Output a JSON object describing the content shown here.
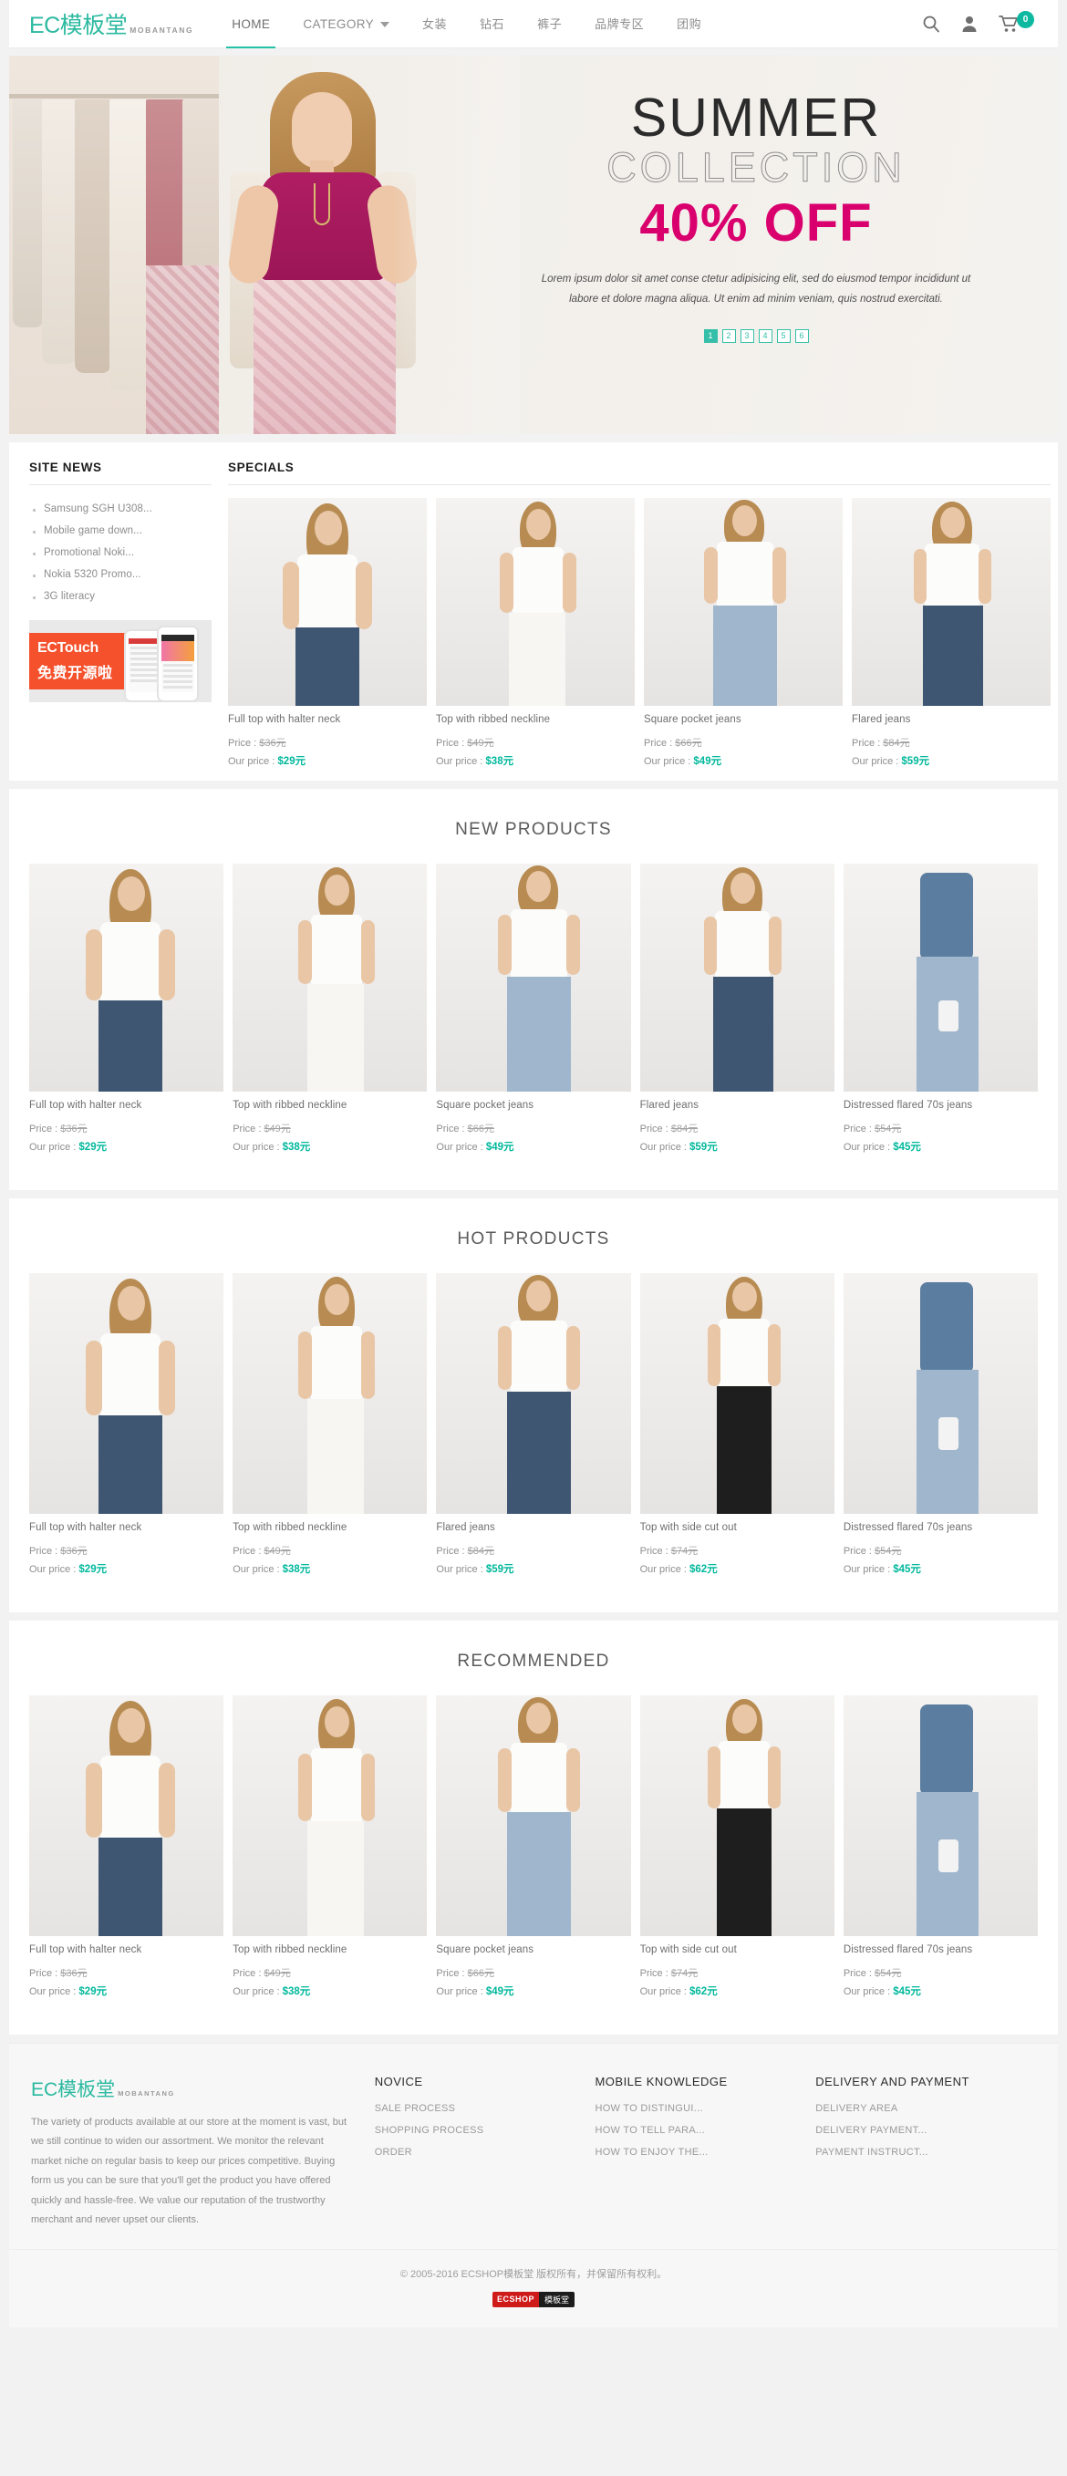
{
  "header": {
    "logo_main": "EC模板堂",
    "logo_sub": "MOBANTANG",
    "nav": [
      {
        "label": "HOME",
        "active": true,
        "caret": false
      },
      {
        "label": "CATEGORY",
        "active": false,
        "caret": true
      },
      {
        "label": "女装",
        "active": false,
        "caret": false
      },
      {
        "label": "钻石",
        "active": false,
        "caret": false
      },
      {
        "label": "裤子",
        "active": false,
        "caret": false
      },
      {
        "label": "品牌专区",
        "active": false,
        "caret": false
      },
      {
        "label": "团购",
        "active": false,
        "caret": false
      }
    ],
    "search_icon": "search-icon",
    "account_icon": "user-icon",
    "cart_icon": "cart-icon",
    "cart_count": "0",
    "accent_color": "#2bb9a0"
  },
  "banner": {
    "title": "SUMMER",
    "subtitle": "COLLECTION",
    "offer": "40% OFF",
    "description": "Lorem ipsum dolor sit amet conse ctetur adipisicing elit, sed do eiusmod tempor incididunt ut labore et dolore magna aliqua. Ut enim ad minim veniam, quis nostrud exercitati.",
    "pager": [
      "1",
      "2",
      "3",
      "4",
      "5",
      "6"
    ],
    "active_page": "1",
    "offer_color": "#d9006e",
    "pager_color": "#35bfa9"
  },
  "site_news": {
    "heading": "SITE NEWS",
    "items": [
      "Samsung SGH U308...",
      "Mobile game down...",
      "Promotional Noki...",
      "Nokia 5320 Promo...",
      "3G literacy"
    ]
  },
  "ad": {
    "line1": "ECTouch",
    "line2": "免费开源啦"
  },
  "specials": {
    "heading": "SPECIALS",
    "products": [
      {
        "title": "Full top with halter neck",
        "price": "Price : ",
        "price_value": "$36元",
        "our_label": "Our price : ",
        "our_value": "$29元"
      },
      {
        "title": "Top with ribbed neckline",
        "price": "Price : ",
        "price_value": "$49元",
        "our_label": "Our price : ",
        "our_value": "$38元"
      },
      {
        "title": "Square pocket jeans",
        "price": "Price : ",
        "price_value": "$66元",
        "our_label": "Our price : ",
        "our_value": "$49元"
      },
      {
        "title": "Flared jeans",
        "price": "Price : ",
        "price_value": "$84元",
        "our_label": "Our price : ",
        "our_value": "$59元"
      }
    ]
  },
  "new_products": {
    "heading": "NEW PRODUCTS",
    "products": [
      {
        "title": "Full top with halter neck",
        "price": "Price : ",
        "price_value": "$36元",
        "our_label": "Our price : ",
        "our_value": "$29元"
      },
      {
        "title": "Top with ribbed neckline",
        "price": "Price : ",
        "price_value": "$49元",
        "our_label": "Our price : ",
        "our_value": "$38元"
      },
      {
        "title": "Square pocket jeans",
        "price": "Price : ",
        "price_value": "$66元",
        "our_label": "Our price : ",
        "our_value": "$49元"
      },
      {
        "title": "Flared jeans",
        "price": "Price : ",
        "price_value": "$84元",
        "our_label": "Our price : ",
        "our_value": "$59元"
      },
      {
        "title": "Distressed flared 70s jeans",
        "price": "Price : ",
        "price_value": "$54元",
        "our_label": "Our price : ",
        "our_value": "$45元"
      }
    ]
  },
  "hot_products": {
    "heading": "HOT PRODUCTS",
    "products": [
      {
        "title": "Full top with halter neck",
        "price": "Price : ",
        "price_value": "$36元",
        "our_label": "Our price : ",
        "our_value": "$29元"
      },
      {
        "title": "Top with ribbed neckline",
        "price": "Price : ",
        "price_value": "$49元",
        "our_label": "Our price : ",
        "our_value": "$38元"
      },
      {
        "title": "Flared jeans",
        "price": "Price : ",
        "price_value": "$84元",
        "our_label": "Our price : ",
        "our_value": "$59元"
      },
      {
        "title": "Top with side cut out",
        "price": "Price : ",
        "price_value": "$74元",
        "our_label": "Our price : ",
        "our_value": "$62元"
      },
      {
        "title": "Distressed flared 70s jeans",
        "price": "Price : ",
        "price_value": "$54元",
        "our_label": "Our price : ",
        "our_value": "$45元"
      }
    ]
  },
  "recommended": {
    "heading": "RECOMMENDED",
    "products": [
      {
        "title": "Full top with halter neck",
        "price": "Price : ",
        "price_value": "$36元",
        "our_label": "Our price : ",
        "our_value": "$29元"
      },
      {
        "title": "Top with ribbed neckline",
        "price": "Price : ",
        "price_value": "$49元",
        "our_label": "Our price : ",
        "our_value": "$38元"
      },
      {
        "title": "Square pocket jeans",
        "price": "Price : ",
        "price_value": "$66元",
        "our_label": "Our price : ",
        "our_value": "$49元"
      },
      {
        "title": "Top with side cut out",
        "price": "Price : ",
        "price_value": "$74元",
        "our_label": "Our price : ",
        "our_value": "$62元"
      },
      {
        "title": "Distressed flared 70s jeans",
        "price": "Price : ",
        "price_value": "$54元",
        "our_label": "Our price : ",
        "our_value": "$45元"
      }
    ]
  },
  "footer": {
    "logo_main": "EC模板堂",
    "logo_sub": "MOBANTANG",
    "about": "The variety of products available at our store at the moment is vast, but we still continue to widen our assortment. We monitor the relevant market niche on regular basis to keep our prices competitive. Buying form us you can be sure that you'll get the product you have offered quickly and hassle-free. We value our reputation of the trustworthy merchant and never upset our clients.",
    "columns": [
      {
        "heading": "NOVICE",
        "links": [
          "SALE PROCESS",
          "SHOPPING PROCESS",
          "ORDER"
        ]
      },
      {
        "heading": "MOBILE KNOWLEDGE",
        "links": [
          "HOW TO DISTINGUI...",
          "HOW TO TELL PARA...",
          "HOW TO ENJOY THE..."
        ]
      },
      {
        "heading": "DELIVERY AND PAYMENT",
        "links": [
          "DELIVERY AREA",
          "DELIVERY PAYMENT...",
          "PAYMENT INSTRUCT..."
        ]
      }
    ],
    "copyright": "© 2005-2016 ECSHOP模板堂 版权所有，并保留所有权利。",
    "badge_left": "ECSHOP",
    "badge_right": "模板堂"
  }
}
